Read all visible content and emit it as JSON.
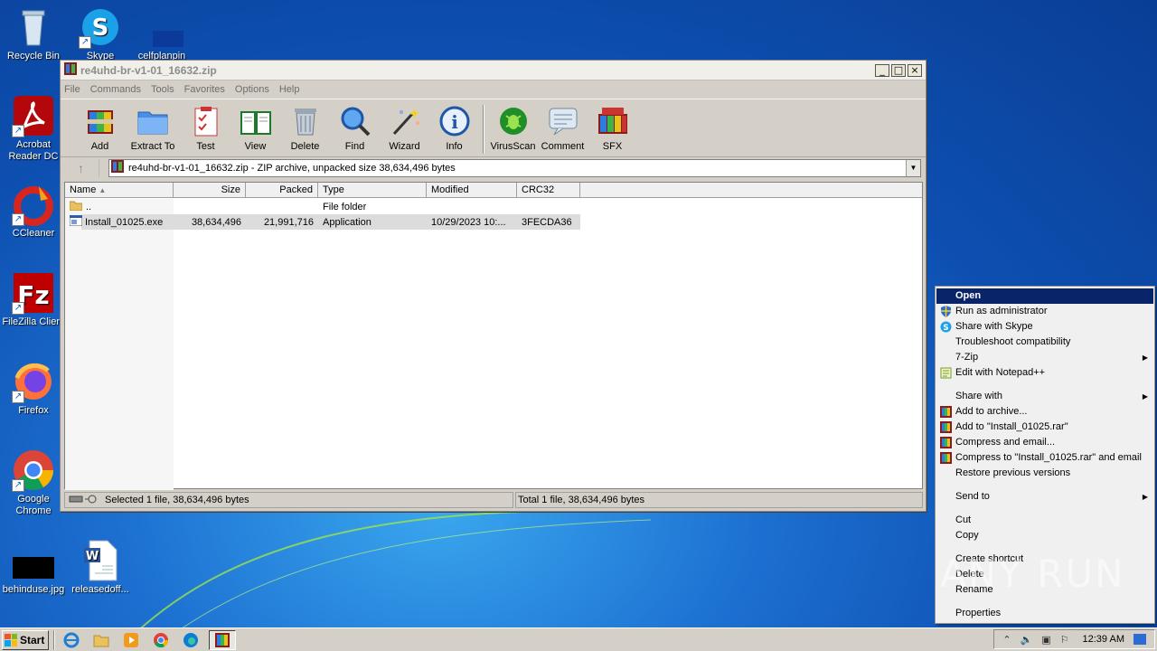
{
  "desktop": {
    "icons": [
      {
        "label": "Recycle Bin",
        "icon": "recycle-bin-icon"
      },
      {
        "label": "Skype",
        "icon": "skype-icon"
      },
      {
        "label": "celfplanpin",
        "icon": "file-icon"
      },
      {
        "label": "Acrobat Reader DC",
        "icon": "acrobat-icon"
      },
      {
        "label": "CCleaner",
        "icon": "ccleaner-icon"
      },
      {
        "label": "FileZilla Client",
        "icon": "filezilla-icon"
      },
      {
        "label": "Firefox",
        "icon": "firefox-icon"
      },
      {
        "label": "Google Chrome",
        "icon": "chrome-icon"
      },
      {
        "label": "behinduse.jpg",
        "icon": "image-file-icon"
      },
      {
        "label": "releasedoff...",
        "icon": "word-doc-icon"
      }
    ]
  },
  "window": {
    "title": "re4uhd-br-v1-01_16632.zip",
    "controls": {
      "minimize": "_",
      "maximize": "□",
      "close": "×"
    },
    "menu": [
      "File",
      "Commands",
      "Tools",
      "Favorites",
      "Options",
      "Help"
    ],
    "toolbar": [
      {
        "label": "Add",
        "icon": "add-archive-icon"
      },
      {
        "label": "Extract To",
        "icon": "extract-folder-icon"
      },
      {
        "label": "Test",
        "icon": "test-clipboard-icon"
      },
      {
        "label": "View",
        "icon": "view-book-icon"
      },
      {
        "label": "Delete",
        "icon": "delete-trash-icon"
      },
      {
        "label": "Find",
        "icon": "find-magnifier-icon"
      },
      {
        "label": "Wizard",
        "icon": "wizard-wand-icon"
      },
      {
        "label": "Info",
        "icon": "info-icon"
      },
      {
        "label": "VirusScan",
        "icon": "virusscan-bug-icon"
      },
      {
        "label": "Comment",
        "icon": "comment-icon"
      },
      {
        "label": "SFX",
        "icon": "sfx-books-icon"
      }
    ],
    "path": "re4uhd-br-v1-01_16632.zip - ZIP archive, unpacked size 38,634,496 bytes",
    "columns": [
      "Name",
      "Size",
      "Packed",
      "Type",
      "Modified",
      "CRC32"
    ],
    "rows": [
      {
        "name": "..",
        "size": "",
        "packed": "",
        "type": "File folder",
        "modified": "",
        "crc": "",
        "selected": false,
        "icon": "folder-icon"
      },
      {
        "name": "Install_01025.exe",
        "size": "38,634,496",
        "packed": "21,991,716",
        "type": "Application",
        "modified": "10/29/2023 10:...",
        "crc": "3FECDA36",
        "selected": true,
        "icon": "exe-file-icon"
      }
    ],
    "status_left": "Selected 1 file, 38,634,496 bytes",
    "status_right": "Total 1 file, 38,634,496 bytes"
  },
  "context_menu": {
    "items": [
      {
        "label": "Open",
        "bold": true,
        "highlight": true
      },
      {
        "label": "Run as administrator",
        "icon": "shield-icon"
      },
      {
        "label": "Share with Skype",
        "icon": "skype-small-icon"
      },
      {
        "label": "Troubleshoot compatibility"
      },
      {
        "label": "7-Zip",
        "submenu": true
      },
      {
        "label": "Edit with Notepad++",
        "icon": "notepadpp-icon"
      },
      {
        "separator": true
      },
      {
        "label": "Share with",
        "submenu": true
      },
      {
        "label": "Add to archive...",
        "icon": "winrar-small-icon"
      },
      {
        "label": "Add to \"Install_01025.rar\"",
        "icon": "winrar-small-icon"
      },
      {
        "label": "Compress and email...",
        "icon": "winrar-small-icon"
      },
      {
        "label": "Compress to \"Install_01025.rar\" and email",
        "icon": "winrar-small-icon"
      },
      {
        "label": "Restore previous versions"
      },
      {
        "separator": true
      },
      {
        "label": "Send to",
        "submenu": true
      },
      {
        "separator": true
      },
      {
        "label": "Cut"
      },
      {
        "label": "Copy"
      },
      {
        "separator": true
      },
      {
        "label": "Create shortcut"
      },
      {
        "label": "Delete"
      },
      {
        "label": "Rename"
      },
      {
        "separator": true
      },
      {
        "label": "Properties"
      }
    ]
  },
  "watermark": "ANY RUN",
  "taskbar": {
    "start_label": "Start",
    "apps": [
      "ie-icon",
      "explorer-icon",
      "media-player-icon",
      "chrome-icon",
      "edge-icon",
      "winrar-icon"
    ],
    "clock": "12:39 AM"
  },
  "colors": {
    "desktop": "#1c6fd0",
    "menu_highlight": "#0a246a",
    "window_face": "#d4d0c8"
  }
}
